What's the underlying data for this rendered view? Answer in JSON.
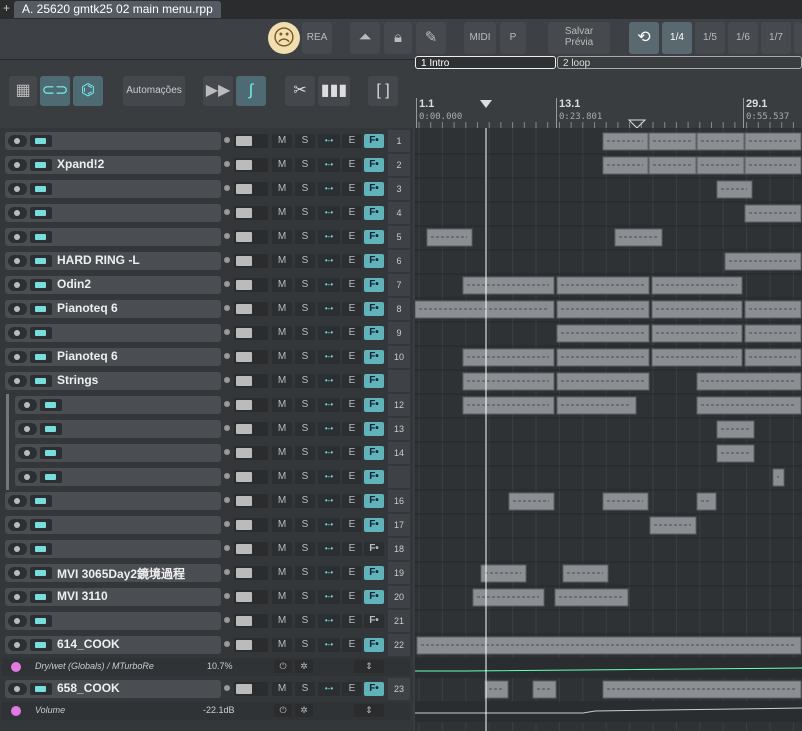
{
  "window": {
    "tab_title": "A. 25620 gmtk25 02 main menu.rpp",
    "tab_plus": "+"
  },
  "toolbar": {
    "rea_label": "REA",
    "midi_label": "MIDI",
    "p_label": "P",
    "save_preview_line1": "Salvar",
    "save_preview_line2": "Prévia",
    "grid_options": [
      "1/4",
      "1/5",
      "1/6",
      "1/7"
    ]
  },
  "tcp_toolbar": {
    "automation_label": "Automações",
    "bracket": "[ ]"
  },
  "regions": [
    {
      "label": "1  Intro"
    },
    {
      "label": "2  loop"
    }
  ],
  "ruler": {
    "marks": [
      {
        "bar": "1.1",
        "time": "0:00.000"
      },
      {
        "bar": "13.1",
        "time": "0:23.801"
      },
      {
        "bar": "29.1",
        "time": "0:55.537"
      }
    ]
  },
  "tracks": [
    {
      "num": "1",
      "name": "",
      "level": 0
    },
    {
      "num": "2",
      "name": "Xpand!2",
      "level": 0
    },
    {
      "num": "3",
      "name": "",
      "level": 0
    },
    {
      "num": "4",
      "name": "",
      "level": 0
    },
    {
      "num": "5",
      "name": "",
      "level": 0
    },
    {
      "num": "6",
      "name": "HARD RING -L",
      "level": 0
    },
    {
      "num": "7",
      "name": "Odin2",
      "level": 0
    },
    {
      "num": "8",
      "name": "Pianoteq 6",
      "level": 0
    },
    {
      "num": "9",
      "name": "",
      "level": 0
    },
    {
      "num": "10",
      "name": "Pianoteq 6",
      "level": 0
    },
    {
      "num": "",
      "name": "Strings",
      "level": 0
    },
    {
      "num": "12",
      "name": "",
      "level": 1
    },
    {
      "num": "13",
      "name": "",
      "level": 1
    },
    {
      "num": "14",
      "name": "",
      "level": 1
    },
    {
      "num": "",
      "name": "",
      "level": 1
    },
    {
      "num": "16",
      "name": "",
      "level": 0
    },
    {
      "num": "17",
      "name": "",
      "level": 0
    },
    {
      "num": "18",
      "name": "",
      "level": 0
    },
    {
      "num": "19",
      "name": "MVI 3065Day2鏡境過程",
      "level": 0
    },
    {
      "num": "20",
      "name": "MVI 3110",
      "level": 0
    },
    {
      "num": "21",
      "name": "",
      "level": 0
    },
    {
      "num": "22",
      "name": "614_COOK",
      "level": 0
    },
    {
      "num": "23",
      "name": "658_COOK",
      "level": 0
    }
  ],
  "track_buttons": {
    "m": "M",
    "s": "S",
    "io": "•-•",
    "e": "E",
    "fx": "F•"
  },
  "envelopes": [
    {
      "name": "Dry/wet (Globals) / MTurboRe",
      "value": "10.7%"
    },
    {
      "name": "Volume",
      "value": "-22.1dB"
    }
  ],
  "icons": [
    "face-icon",
    "metronome-icon",
    "lock-icon",
    "pencil-icon",
    "loop-icon",
    "grid-icon",
    "link-icon",
    "automation-icon",
    "play-icon",
    "curve-icon"
  ]
}
